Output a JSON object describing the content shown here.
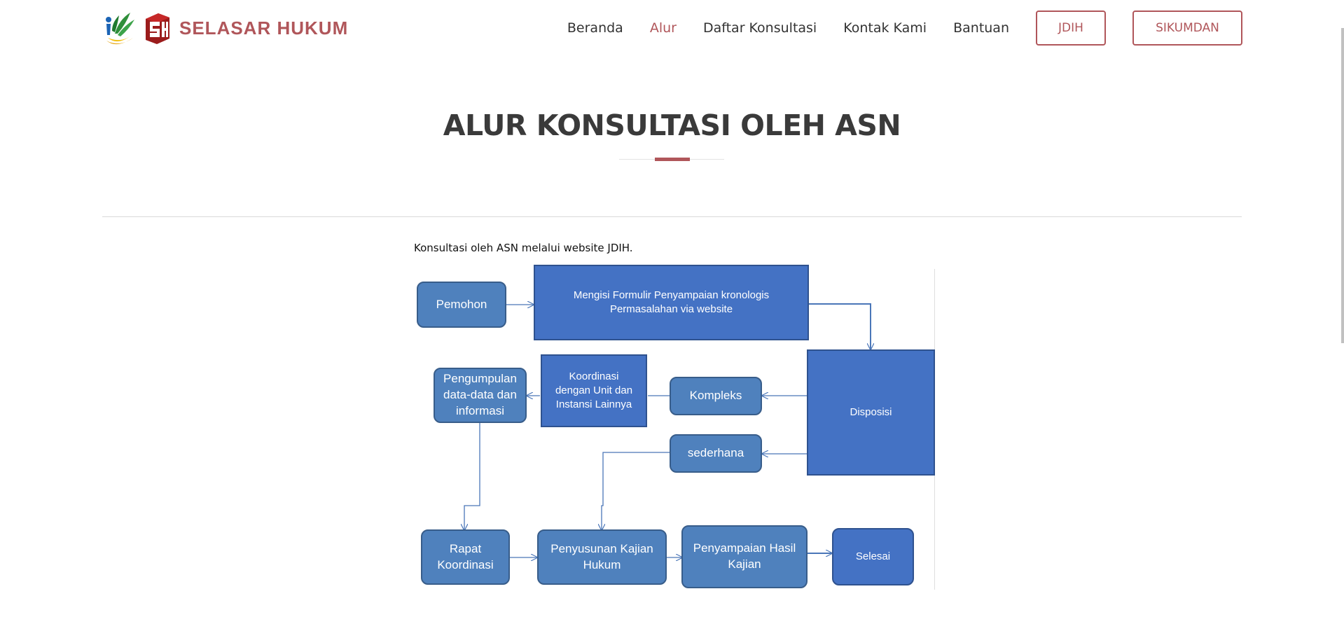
{
  "header": {
    "brand": "SELASAR HUKUM",
    "nav": [
      {
        "label": "Beranda"
      },
      {
        "label": "Alur",
        "active": true
      },
      {
        "label": "Daftar Konsultasi"
      },
      {
        "label": "Kontak Kami"
      },
      {
        "label": "Bantuan"
      }
    ],
    "buttons": {
      "jdih": "JDIH",
      "sikumdan": "SIKUMDAN"
    },
    "accent_color": "#b0565a"
  },
  "page": {
    "title": "ALUR KONSULTASI OLEH ASN",
    "caption": "Konsultasi oleh ASN melalui website JDIH."
  },
  "diagram": {
    "nodes": {
      "pemohon": "Pemohon",
      "formulir": "Mengisi Formulir Penyampaian kronologis Permasalahan via website",
      "disposisi": "Disposisi",
      "kompleks": "Kompleks",
      "koordinasi": "Koordinasi dengan Unit dan Instansi Lainnya",
      "pengumpulan": "Pengumpulan data-data dan informasi",
      "sederhana": "sederhana",
      "rapat": "Rapat Koordinasi",
      "penyusunan": "Penyusunan Kajian Hukum",
      "penyampaian": "Penyampaian Hasil Kajian",
      "selesai": "Selesai"
    },
    "colors": {
      "rounded_fill": "#4f81bd",
      "square_fill": "#4472c4",
      "connector": "#4a76b8"
    }
  }
}
